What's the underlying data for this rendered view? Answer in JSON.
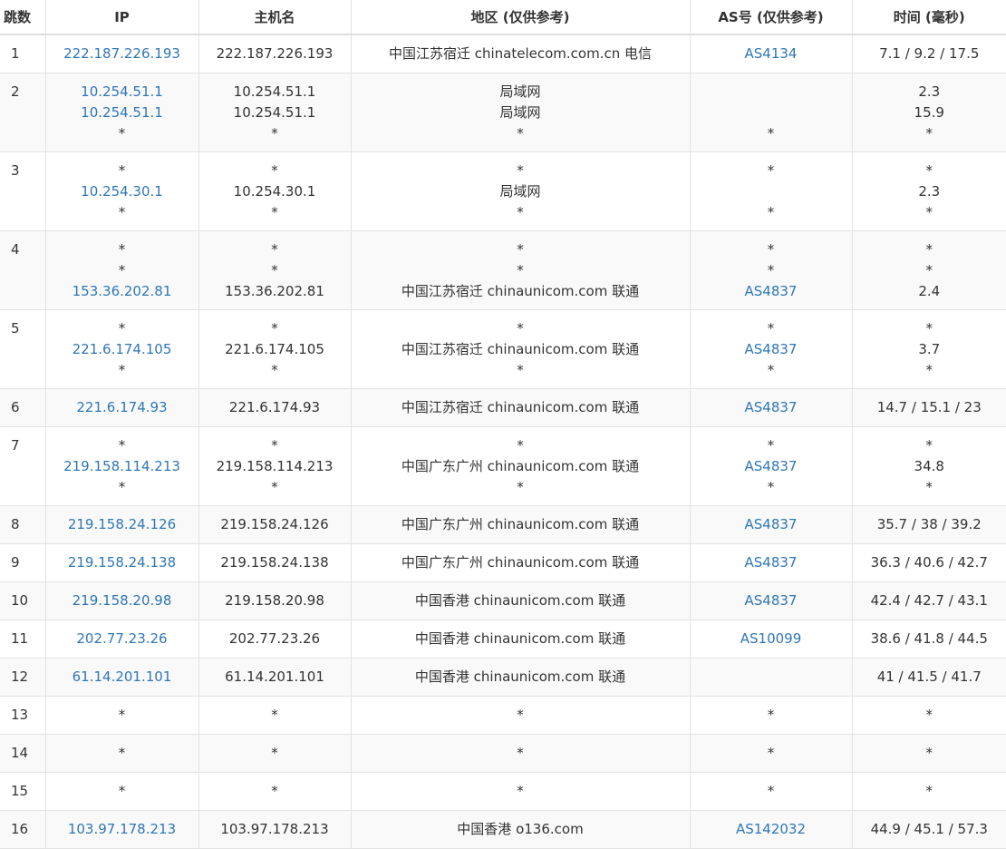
{
  "headers": [
    "跳数",
    "IP",
    "主机名",
    "地区 (仅供参考)",
    "AS号 (仅供参考)",
    "时间 (毫秒)"
  ],
  "rows": [
    {
      "hop": "1",
      "ip": [
        "222.187.226.193"
      ],
      "host": [
        "222.187.226.193"
      ],
      "region": [
        "中国江苏宿迁 chinatelecom.com.cn 电信"
      ],
      "as": [
        "AS4134"
      ],
      "time": [
        "7.1 / 9.2 / 17.5"
      ]
    },
    {
      "hop": "2",
      "ip": [
        "10.254.51.1",
        "10.254.51.1",
        "*"
      ],
      "host": [
        "10.254.51.1",
        "10.254.51.1",
        "*"
      ],
      "region": [
        "局域网",
        "局域网",
        "*"
      ],
      "as": [
        "",
        "",
        "*"
      ],
      "time": [
        "2.3",
        "15.9",
        "*"
      ]
    },
    {
      "hop": "3",
      "ip": [
        "*",
        "10.254.30.1",
        "*"
      ],
      "host": [
        "*",
        "10.254.30.1",
        "*"
      ],
      "region": [
        "*",
        "局域网",
        "*"
      ],
      "as": [
        "*",
        "",
        "*"
      ],
      "time": [
        "*",
        "2.3",
        "*"
      ]
    },
    {
      "hop": "4",
      "ip": [
        "*",
        "*",
        "153.36.202.81"
      ],
      "host": [
        "*",
        "*",
        "153.36.202.81"
      ],
      "region": [
        "*",
        "*",
        "中国江苏宿迁 chinaunicom.com 联通"
      ],
      "as": [
        "*",
        "*",
        "AS4837"
      ],
      "time": [
        "*",
        "*",
        "2.4"
      ]
    },
    {
      "hop": "5",
      "ip": [
        "*",
        "221.6.174.105",
        "*"
      ],
      "host": [
        "*",
        "221.6.174.105",
        "*"
      ],
      "region": [
        "*",
        "中国江苏宿迁 chinaunicom.com 联通",
        "*"
      ],
      "as": [
        "*",
        "AS4837",
        "*"
      ],
      "time": [
        "*",
        "3.7",
        "*"
      ]
    },
    {
      "hop": "6",
      "ip": [
        "221.6.174.93"
      ],
      "host": [
        "221.6.174.93"
      ],
      "region": [
        "中国江苏宿迁 chinaunicom.com 联通"
      ],
      "as": [
        "AS4837"
      ],
      "time": [
        "14.7 / 15.1 / 23"
      ]
    },
    {
      "hop": "7",
      "ip": [
        "*",
        "219.158.114.213",
        "*"
      ],
      "host": [
        "*",
        "219.158.114.213",
        "*"
      ],
      "region": [
        "*",
        "中国广东广州 chinaunicom.com 联通",
        "*"
      ],
      "as": [
        "*",
        "AS4837",
        "*"
      ],
      "time": [
        "*",
        "34.8",
        "*"
      ]
    },
    {
      "hop": "8",
      "ip": [
        "219.158.24.126"
      ],
      "host": [
        "219.158.24.126"
      ],
      "region": [
        "中国广东广州 chinaunicom.com 联通"
      ],
      "as": [
        "AS4837"
      ],
      "time": [
        "35.7 / 38 / 39.2"
      ]
    },
    {
      "hop": "9",
      "ip": [
        "219.158.24.138"
      ],
      "host": [
        "219.158.24.138"
      ],
      "region": [
        "中国广东广州 chinaunicom.com 联通"
      ],
      "as": [
        "AS4837"
      ],
      "time": [
        "36.3 / 40.6 / 42.7"
      ]
    },
    {
      "hop": "10",
      "ip": [
        "219.158.20.98"
      ],
      "host": [
        "219.158.20.98"
      ],
      "region": [
        "中国香港 chinaunicom.com 联通"
      ],
      "as": [
        "AS4837"
      ],
      "time": [
        "42.4 / 42.7 / 43.1"
      ]
    },
    {
      "hop": "11",
      "ip": [
        "202.77.23.26"
      ],
      "host": [
        "202.77.23.26"
      ],
      "region": [
        "中国香港 chinaunicom.com 联通"
      ],
      "as": [
        "AS10099"
      ],
      "time": [
        "38.6 / 41.8 / 44.5"
      ]
    },
    {
      "hop": "12",
      "ip": [
        "61.14.201.101"
      ],
      "host": [
        "61.14.201.101"
      ],
      "region": [
        "中国香港 chinaunicom.com 联通"
      ],
      "as": [
        ""
      ],
      "time": [
        "41 / 41.5 / 41.7"
      ]
    },
    {
      "hop": "13",
      "ip": [
        "*"
      ],
      "host": [
        "*"
      ],
      "region": [
        "*"
      ],
      "as": [
        "*"
      ],
      "time": [
        "*"
      ]
    },
    {
      "hop": "14",
      "ip": [
        "*"
      ],
      "host": [
        "*"
      ],
      "region": [
        "*"
      ],
      "as": [
        "*"
      ],
      "time": [
        "*"
      ]
    },
    {
      "hop": "15",
      "ip": [
        "*"
      ],
      "host": [
        "*"
      ],
      "region": [
        "*"
      ],
      "as": [
        "*"
      ],
      "time": [
        "*"
      ]
    },
    {
      "hop": "16",
      "ip": [
        "103.97.178.213"
      ],
      "host": [
        "103.97.178.213"
      ],
      "region": [
        "中国香港 o136.com"
      ],
      "as": [
        "AS142032"
      ],
      "time": [
        "44.9 / 45.1 / 57.3"
      ]
    }
  ],
  "colors": {
    "link": "#2f76b6",
    "text": "#333333",
    "border": "#e3e3e3",
    "row_alt": "#f9f9f9"
  }
}
